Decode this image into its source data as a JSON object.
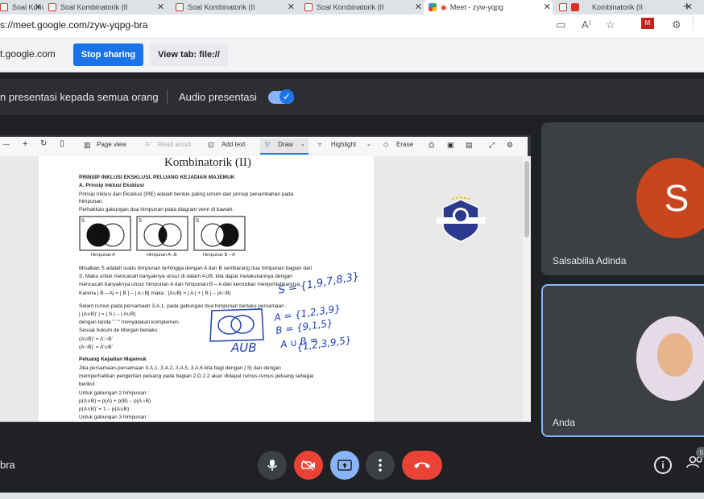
{
  "tabs": [
    {
      "title": "Soal Kombinatorik (I)",
      "type": "pdf"
    },
    {
      "title": "Soal Kombinatorik (II",
      "type": "pdf"
    },
    {
      "title": "Soal Kombinatorik (II",
      "type": "pdf"
    },
    {
      "title": "Soal Kombinatorik (II",
      "type": "pdf"
    },
    {
      "title": "Meet - zyw-yqpg",
      "type": "meet"
    },
    {
      "title": "Kombinatorik (II",
      "type": "pdf"
    }
  ],
  "url": "s://meet.google.com/zyw-yqpg-bra",
  "sharebar": {
    "sharing_text": "t.google.com",
    "stop_label": "Stop sharing",
    "view_label": "View tab: file://"
  },
  "presentation_bar": {
    "text": "n presentasi kepada semua orang",
    "audio_label": "Audio presentasi",
    "audio_enabled": true
  },
  "pdf_toolbar": {
    "page_view": "Page view",
    "read_aloud": "Read aloud",
    "add_text": "Add text",
    "draw": "Draw",
    "highlight": "Highlight",
    "erase": "Erase"
  },
  "document": {
    "title": "Kombinatorik (II)",
    "heading": "PRINSIP INKLUSI EKSKLUSI, PELUANG KEJADIAN MAJEMUK",
    "sub_a": "A. Prinsip Inklusi Eksklusi",
    "p1": "Prinsip Inklusi dan Eksklusi (PIE) adalah bentuk paling umum dari prinsip penambahan pada",
    "p1b": "himpunan.",
    "p2": "Perhatikan gabungan dua himpunan pada diagram venn di bawah.",
    "venn_captions": [
      "Himpunan A",
      "Himpunan A∩B",
      "Himpunan B – A"
    ],
    "p3": "Misalkan S adalah suatu himpunan terhingga dengan A dan B sembarang dua himpunan bagian dari",
    "p3b": "S. Maka untuk mencacah banyaknya unsur di dalam A∪B, kita dapat melakukannya dengan",
    "p3c": "mencacah banyaknya unsur himpunan A dan himpunan B – A dan kemudian menjumlahkannya.",
    "p3d": "Karena | B – A| = | B | – | A∩B| maka : |A∪B| = | A | + | B | – |A∩B|",
    "p4": "Selain rumus pada persamaan 3.A.1, pada gabungan dua himpunan berlaku persamaan :",
    "p4b": "| (A∪B)' | = | S | – | A∪B|",
    "p4c": "dengan tanda \" ' \" menyatakan komplemen.",
    "p4d": "Sesuai hukum de Morgan berlaku :",
    "p4e": "(A∪B)' = A'∩B'",
    "p4f": "(A∩B)' = A'∪B'",
    "sub_b": "Peluang Kejadian Majemuk",
    "p5": "Jika persamaan-persamaan 3.A.1, 3.A.2, 3.A.5, 3.A.6 kita bagi dengan | S| dan dengan",
    "p5b": "memperhatikan pengertian peluang pada bagian 2.D.2.2 akan didapat rumus-rumus peluang sebagai",
    "p5c": "berikut :",
    "p5d": "Untuk gabungan 2 himpunan :",
    "p5e": "p(A∪B) = p(A) + p(B) – p(A∩B)",
    "p5f": "p(A∪B)' = 1 – p(A∪B)",
    "p5g": "Untuk gabungan 3 himpunan :"
  },
  "annotations": {
    "s_set": "S = {1,9,7,8,3}",
    "a_set": "A = {1,2,3,9}",
    "b_set": "B = {9,1,5}",
    "aub_label": "A∪B",
    "aub_eq": "A ∪ B =",
    "aub_set": "{1,2,3,9,5}",
    "circle_label": "AUB"
  },
  "participants": [
    {
      "name": "Salsabilla Adinda",
      "initial": "S",
      "avatar_color": "#c8451d"
    },
    {
      "name": "Anda"
    }
  ],
  "meeting_code": "bra",
  "people_count": "5",
  "colors": {
    "accent": "#1a73e8",
    "leave_red": "#ea4335",
    "present_blue": "#8ab4f8",
    "ink_blue": "#1f3fb0"
  }
}
